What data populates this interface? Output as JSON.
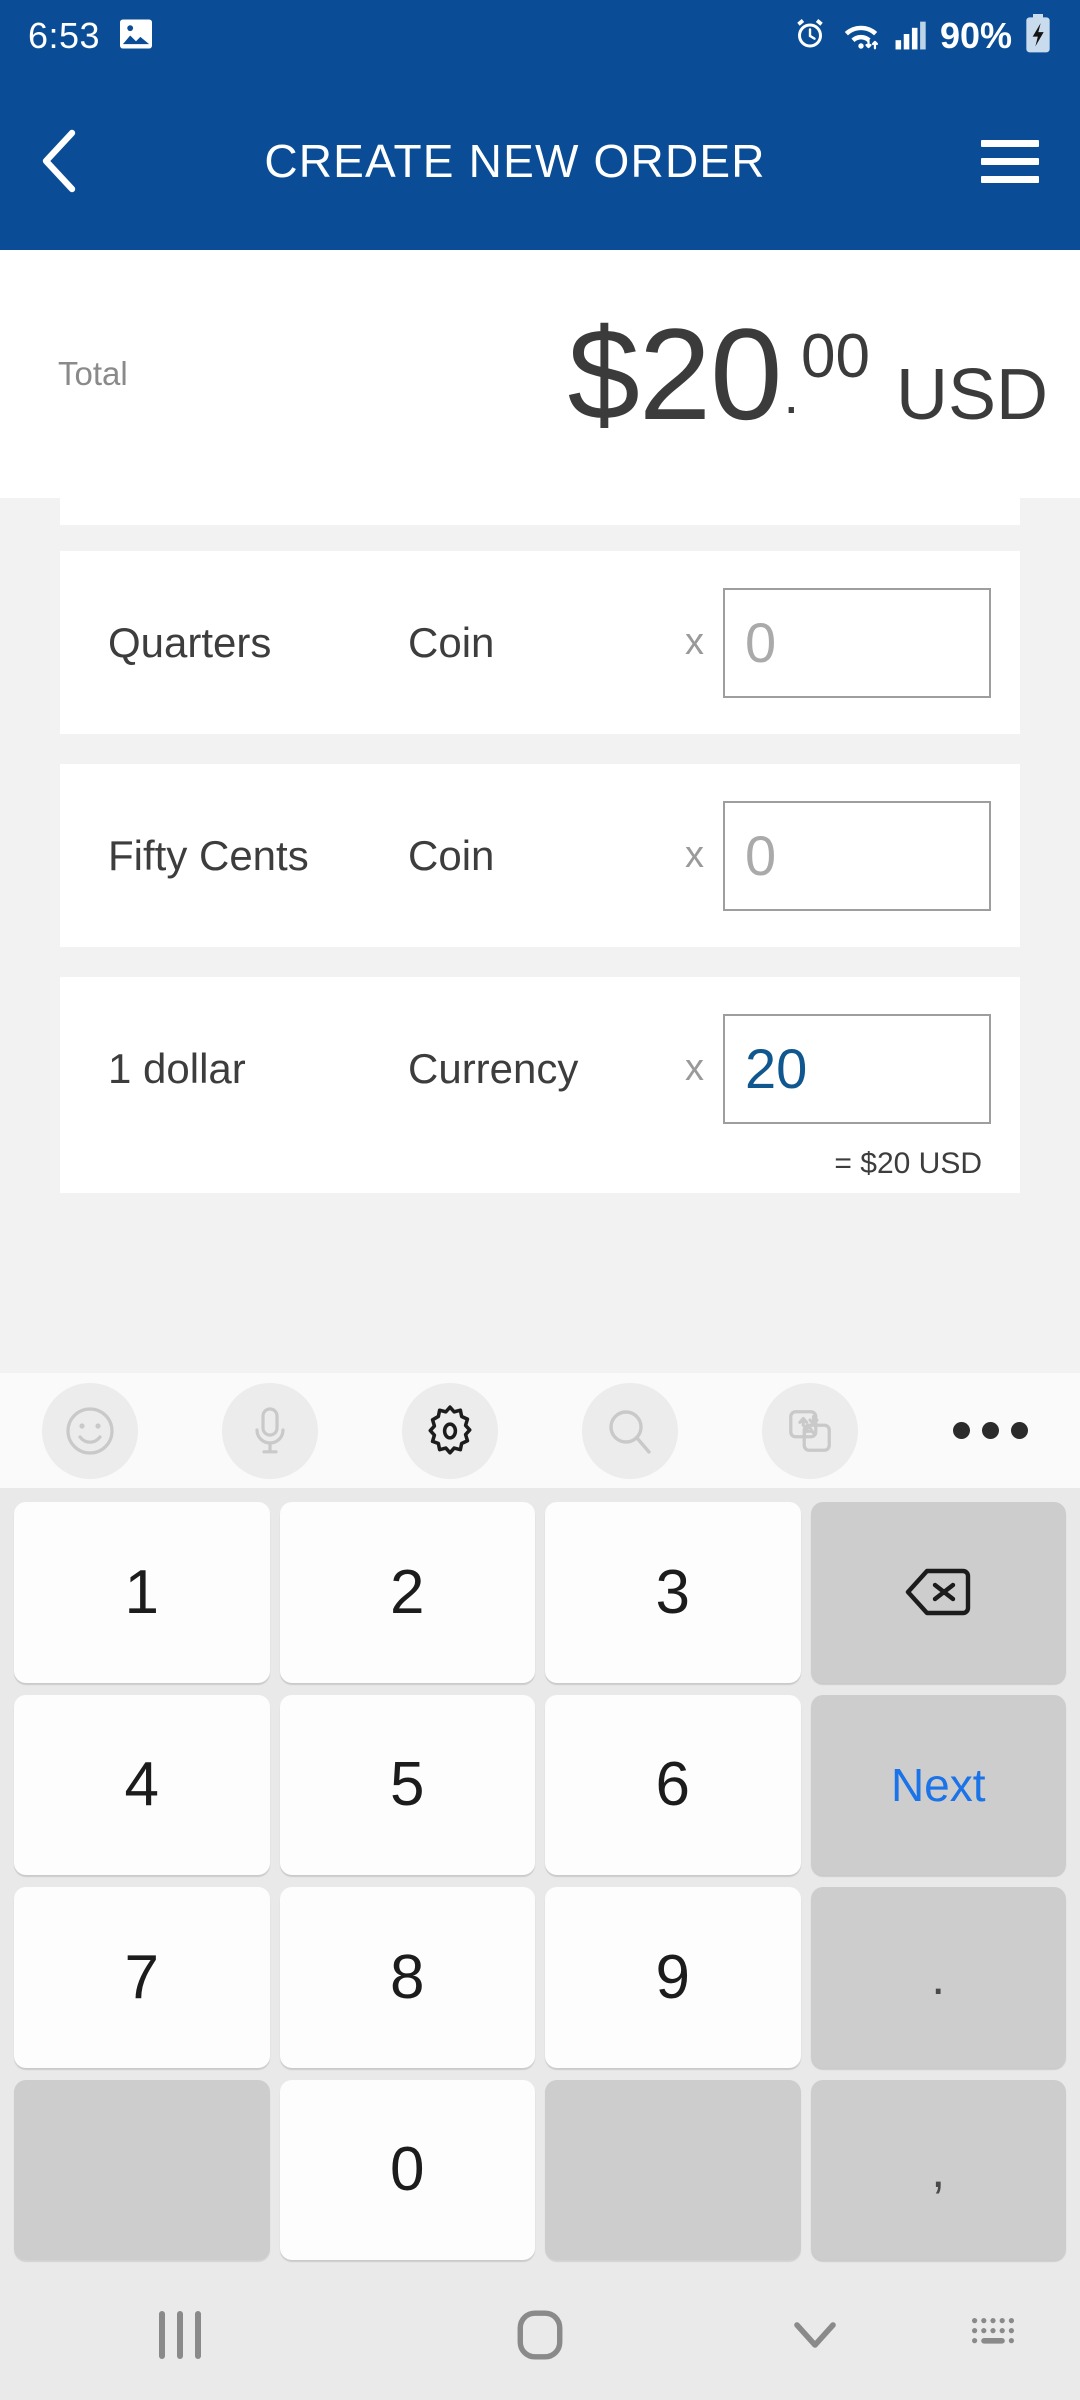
{
  "status_bar": {
    "time": "6:53",
    "battery_percent": "90%",
    "icons": [
      "screenshot-image-icon",
      "alarm-icon",
      "wifi-icon",
      "signal-icon",
      "battery-charging-icon"
    ]
  },
  "app_bar": {
    "title": "CREATE NEW ORDER",
    "back_icon": "chevron-left-icon",
    "menu_icon": "hamburger-menu-icon"
  },
  "total_panel": {
    "label": "Total",
    "amount_whole": "$20",
    "separator": ".",
    "amount_cents": "00",
    "currency": "USD"
  },
  "denomination_rows": [
    {
      "denomination": "Quarters",
      "kind": "Coin",
      "multiply_symbol": "x",
      "quantity": "",
      "quantity_placeholder": "0",
      "conversion": ""
    },
    {
      "denomination": "Fifty Cents",
      "kind": "Coin",
      "multiply_symbol": "x",
      "quantity": "",
      "quantity_placeholder": "0",
      "conversion": ""
    },
    {
      "denomination": "1 dollar",
      "kind": "Currency",
      "multiply_symbol": "x",
      "quantity": "20",
      "quantity_placeholder": "0",
      "conversion": "= $20 USD"
    }
  ],
  "keyboard": {
    "toolbar_icons": [
      "emoji-smiley-icon",
      "microphone-icon",
      "settings-gear-icon",
      "search-icon",
      "translate-icon",
      "overflow-menu-icon"
    ],
    "keys": [
      {
        "label": "1",
        "type": "num"
      },
      {
        "label": "2",
        "type": "num"
      },
      {
        "label": "3",
        "type": "num"
      },
      {
        "label": "",
        "type": "backspace"
      },
      {
        "label": "4",
        "type": "num"
      },
      {
        "label": "5",
        "type": "num"
      },
      {
        "label": "6",
        "type": "num"
      },
      {
        "label": "Next",
        "type": "next"
      },
      {
        "label": "7",
        "type": "num"
      },
      {
        "label": "8",
        "type": "num"
      },
      {
        "label": "9",
        "type": "num"
      },
      {
        "label": ".",
        "type": "punct"
      },
      {
        "label": "",
        "type": "blank"
      },
      {
        "label": "0",
        "type": "num"
      },
      {
        "label": "",
        "type": "blank"
      },
      {
        "label": ",",
        "type": "punct"
      }
    ]
  },
  "nav_bar": {
    "icons": [
      "recents-icon",
      "home-icon",
      "hide-keyboard-chevron-down-icon",
      "keyboard-switch-icon"
    ]
  },
  "colors": {
    "header_blue": "#0a4d96",
    "input_value_blue": "#11578f",
    "next_key_blue": "#1a73e8",
    "list_background": "#f2f2f2",
    "keypad_background": "#e9e9e9"
  }
}
